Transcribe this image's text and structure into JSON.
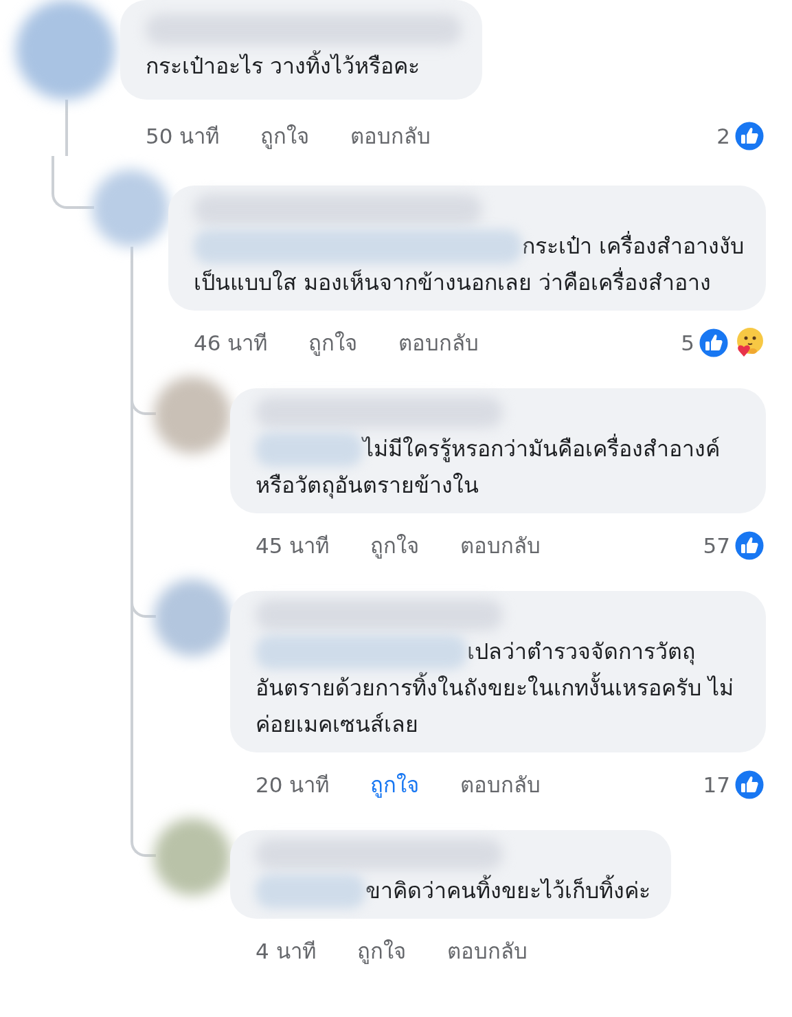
{
  "comments": [
    {
      "text": "กระเป๋าอะไร วางทิ้งไว้หรือคะ",
      "time": "50 นาที",
      "like_label": "ถูกใจ",
      "liked": false,
      "reply_label": "ตอบกลับ",
      "reaction_count": "2",
      "reactions": [
        {
          "kind": "like"
        }
      ],
      "children": [
        {
          "text": "กระเป๋า เครื่องสำอางงับ เป็นแบบใส มองเห็นจากข้างนอกเลย ว่าคือเครื่องสำอาง",
          "time": "46 นาที",
          "like_label": "ถูกใจ",
          "liked": false,
          "reply_label": "ตอบกลับ",
          "reaction_count": "5",
          "reactions": [
            {
              "kind": "like"
            },
            {
              "kind": "care"
            }
          ],
          "children": [
            {
              "text": "ไม่มีใครรู้หรอกว่ามันคือเครื่องสำอางค์หรือวัตถุอันตรายข้างใน",
              "time": "45 นาที",
              "like_label": "ถูกใจ",
              "liked": false,
              "reply_label": "ตอบกลับ",
              "reaction_count": "57",
              "reactions": [
                {
                  "kind": "like"
                }
              ]
            },
            {
              "text": "เปลว่าตำรวจจัดการวัตถุอันตรายด้วยการทิ้งในถังขยะในเกทงั้นเหรอครับ ไม่ค่อยเมคเซนส์เลย",
              "time": "20 นาที",
              "like_label": "ถูกใจ",
              "liked": true,
              "reply_label": "ตอบกลับ",
              "reaction_count": "17",
              "reactions": [
                {
                  "kind": "like"
                }
              ]
            },
            {
              "text": "ขาคิดว่าคนทิ้งขยะไว้เก็บทิ้งค่ะ",
              "time": "4 นาที",
              "like_label": "ถูกใจ",
              "liked": false,
              "reply_label": "ตอบกลับ"
            }
          ]
        }
      ]
    }
  ]
}
